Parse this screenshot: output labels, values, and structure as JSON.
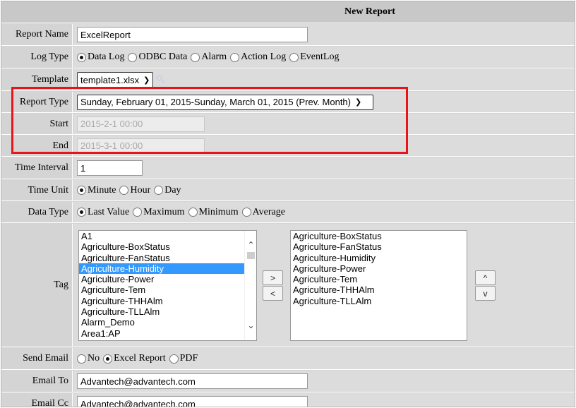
{
  "header": {
    "title": "New Report"
  },
  "report_name": {
    "label": "Report Name",
    "value": "ExcelReport"
  },
  "log_type": {
    "label": "Log Type",
    "options": [
      "Data Log",
      "ODBC Data",
      "Alarm",
      "Action Log",
      "EventLog"
    ],
    "selected": "Data Log"
  },
  "template": {
    "label": "Template",
    "value": "template1.xlsx",
    "icon": "search-icon"
  },
  "report_type": {
    "label": "Report Type",
    "value": "Sunday, February 01, 2015-Sunday, March 01, 2015 (Prev. Month)"
  },
  "start": {
    "label": "Start",
    "value": "2015-2-1 00:00"
  },
  "end": {
    "label": "End",
    "value": "2015-3-1 00:00"
  },
  "time_interval": {
    "label": "Time Interval",
    "value": "1"
  },
  "time_unit": {
    "label": "Time Unit",
    "options": [
      "Minute",
      "Hour",
      "Day"
    ],
    "selected": "Minute"
  },
  "data_type": {
    "label": "Data Type",
    "options": [
      "Last Value",
      "Maximum",
      "Minimum",
      "Average"
    ],
    "selected": "Last Value"
  },
  "tag": {
    "label": "Tag",
    "available": [
      "A1",
      "Agriculture-BoxStatus",
      "Agriculture-FanStatus",
      "Agriculture-Humidity",
      "Agriculture-Power",
      "Agriculture-Tem",
      "Agriculture-THHAlm",
      "Agriculture-TLLAlm",
      "Alarm_Demo",
      "Area1:AP"
    ],
    "available_selected": "Agriculture-Humidity",
    "chosen": [
      "Agriculture-BoxStatus",
      "Agriculture-FanStatus",
      "Agriculture-Humidity",
      "Agriculture-Power",
      "Agriculture-Tem",
      "Agriculture-THHAlm",
      "Agriculture-TLLAlm"
    ],
    "add_label": ">",
    "remove_label": "<",
    "up_label": "^",
    "down_label": "v"
  },
  "send_email": {
    "label": "Send Email",
    "options": [
      "No",
      "Excel Report",
      "PDF"
    ],
    "selected": "Excel Report"
  },
  "email_to": {
    "label": "Email To",
    "value": "Advantech@advantech.com"
  },
  "email_cc": {
    "label": "Email Cc",
    "value": "Advantech@advantech.com"
  },
  "colors": {
    "highlight": "#e8141a",
    "selection": "#3399ff"
  }
}
